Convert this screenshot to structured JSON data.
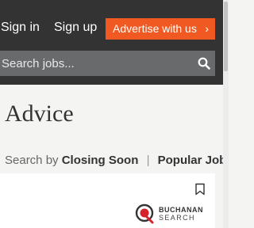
{
  "header": {
    "sign_in": "Sign in",
    "sign_up": "Sign up",
    "advertise_label": "Advertise with us",
    "advertise_chevron": "›"
  },
  "search": {
    "placeholder": "Search jobs...",
    "value": ""
  },
  "main": {
    "title": "Advice",
    "search_by_prefix": "Search by",
    "links": [
      "Closing Soon",
      "Popular Jobs"
    ],
    "separator": "|"
  },
  "job_card": {
    "logo_name": "BUCHANAN",
    "logo_sub": "SEARCH"
  },
  "colors": {
    "header_bg": "#333333",
    "accent": "#f05a22",
    "search_bg": "#686a6c",
    "page_bg": "#f4f4f2",
    "logo_red": "#d6202a"
  },
  "icons": {
    "search": "search-icon",
    "bookmark": "bookmark-icon",
    "chevron": "chevron-right-icon"
  }
}
